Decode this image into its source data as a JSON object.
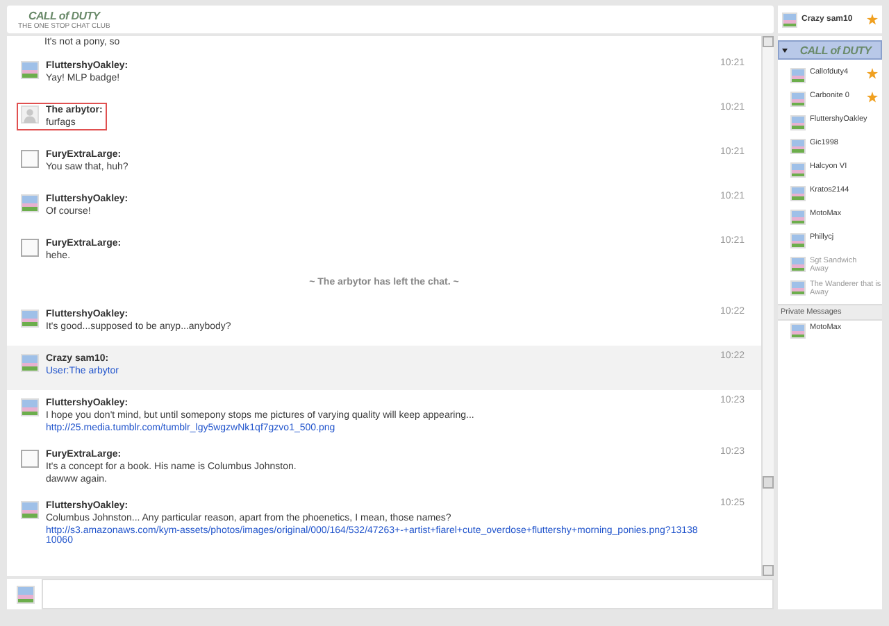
{
  "header": {
    "logo": "CALL of DUTY",
    "tagline": "THE ONE STOP CHAT CLUB",
    "user": {
      "name": "Crazy sam10",
      "starred": true
    }
  },
  "chat": {
    "entries": [
      {
        "kind": "continuation",
        "lines": [
          "It's not a pony, so"
        ]
      },
      {
        "kind": "message",
        "user": "FluttershyOakley:",
        "avatar": {
          "kind": "image"
        },
        "time": "10:21",
        "lines": [
          "Yay! MLP badge!"
        ],
        "highlighted": false,
        "outlined": false
      },
      {
        "kind": "message",
        "user": "The arbytor:",
        "avatar": {
          "kind": "default"
        },
        "time": "10:21",
        "lines": [
          "furfags"
        ],
        "highlighted": false,
        "outlined": true
      },
      {
        "kind": "message",
        "user": "FuryExtraLarge:",
        "avatar": {
          "kind": "sketch"
        },
        "time": "10:21",
        "lines": [
          "You saw that, huh?"
        ],
        "highlighted": false,
        "outlined": false
      },
      {
        "kind": "message",
        "user": "FluttershyOakley:",
        "avatar": {
          "kind": "image"
        },
        "time": "10:21",
        "lines": [
          "Of course!"
        ],
        "highlighted": false,
        "outlined": false
      },
      {
        "kind": "message",
        "user": "FuryExtraLarge:",
        "avatar": {
          "kind": "sketch"
        },
        "time": "10:21",
        "lines": [
          "hehe."
        ],
        "highlighted": false,
        "outlined": false
      },
      {
        "kind": "alert",
        "text": "~ The arbytor has left the chat. ~"
      },
      {
        "kind": "message",
        "user": "FluttershyOakley:",
        "avatar": {
          "kind": "image"
        },
        "time": "10:22",
        "lines": [
          "It's good...supposed to be anyp...anybody?"
        ],
        "highlighted": false,
        "outlined": false
      },
      {
        "kind": "message",
        "user": "Crazy sam10:",
        "avatar": {
          "kind": "image"
        },
        "time": "10:22",
        "link": "User:The arbytor",
        "highlighted": true,
        "outlined": false
      },
      {
        "kind": "message",
        "user": "FluttershyOakley:",
        "avatar": {
          "kind": "image"
        },
        "time": "10:23",
        "lines": [
          "I hope you don't mind, but until somepony stops me pictures of varying quality will keep appearing..."
        ],
        "link": "http://25.media.tumblr.com/tumblr_lgy5wgzwNk1qf7gzvo1_500.png",
        "highlighted": false,
        "outlined": false
      },
      {
        "kind": "message",
        "user": "FuryExtraLarge:",
        "avatar": {
          "kind": "sketch"
        },
        "time": "10:23",
        "lines": [
          "It's a concept for a book. His name is Columbus Johnston.",
          "dawww again."
        ],
        "highlighted": false,
        "outlined": false
      },
      {
        "kind": "message",
        "user": "FluttershyOakley:",
        "avatar": {
          "kind": "image"
        },
        "time": "10:25",
        "lines": [
          "Columbus Johnston... Any particular reason, apart from the phoenetics, I mean, those names?"
        ],
        "link": "http://s3.amazonaws.com/kym-assets/photos/images/original/000/164/532/47263+-+artist+fiarel+cute_overdose+fluttershy+morning_ponies.png?1313810060",
        "highlighted": false,
        "outlined": false
      }
    ]
  },
  "banner_logo": "CALL of DUTY",
  "users": [
    {
      "name": "Callofduty4",
      "starred": true,
      "away": false
    },
    {
      "name": "Carbonite 0",
      "starred": true,
      "away": false
    },
    {
      "name": "FluttershyOakley",
      "starred": false,
      "away": false
    },
    {
      "name": "Gic1998",
      "starred": false,
      "away": false
    },
    {
      "name": "Halcyon VI",
      "starred": false,
      "away": false
    },
    {
      "name": "Kratos2144",
      "starred": false,
      "away": false
    },
    {
      "name": "MotoMax",
      "starred": false,
      "away": false
    },
    {
      "name": "Phillycj",
      "starred": false,
      "away": false
    },
    {
      "name": "Sgt Sandwich",
      "starred": false,
      "away": true,
      "status": "Away"
    },
    {
      "name": "The Wanderer that is",
      "starred": false,
      "away": true,
      "status": "Away"
    }
  ],
  "private_messages": {
    "title": "Private Messages",
    "users": [
      {
        "name": "MotoMax"
      }
    ]
  }
}
